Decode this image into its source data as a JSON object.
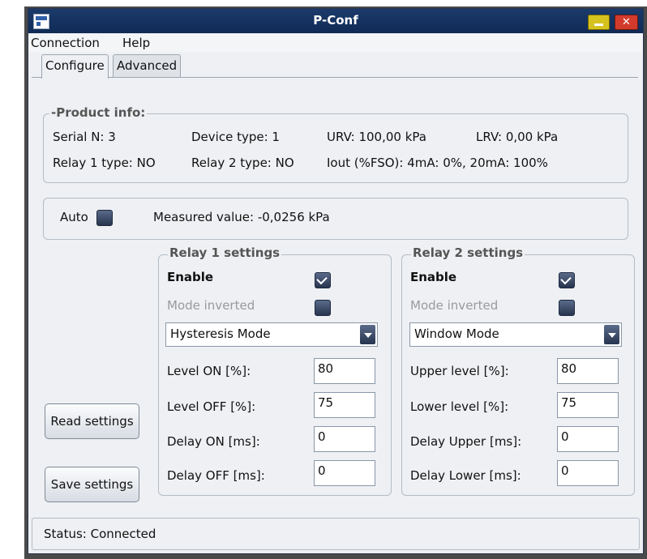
{
  "window": {
    "title": "P-Conf"
  },
  "menu": {
    "items": [
      "Connection",
      "Help"
    ]
  },
  "tabs": [
    "Configure",
    "Advanced"
  ],
  "product_info": {
    "title": "-Product info:",
    "serial": "Serial N: 3",
    "device_type": "Device type: 1",
    "urv": "URV: 100,00 kPa",
    "lrv": "LRV: 0,00 kPa",
    "relay1_type": "Relay 1 type: NO",
    "relay2_type": "Relay 2 type: NO",
    "iout": "Iout (%FSO):  4mA: 0%,  20mA: 100%"
  },
  "measure": {
    "auto_label": "Auto",
    "auto_checked": false,
    "measured_value": "Measured value: -0,0256 kPa"
  },
  "relay1": {
    "title": "Relay 1 settings",
    "enable_label": "Enable",
    "enable_checked": true,
    "mode_inverted_label": "Mode inverted",
    "mode_inverted_checked": false,
    "mode": "Hysteresis Mode",
    "fields": [
      {
        "label": "Level ON   [%]:",
        "value": "80"
      },
      {
        "label": "Level OFF  [%]:",
        "value": "75"
      },
      {
        "label": "Delay ON  [ms]:",
        "value": "0"
      },
      {
        "label": "Delay OFF [ms]:",
        "value": "0"
      }
    ]
  },
  "relay2": {
    "title": "Relay 2 settings",
    "enable_label": "Enable",
    "enable_checked": true,
    "mode_inverted_label": "Mode inverted",
    "mode_inverted_checked": false,
    "mode": "Window Mode",
    "fields": [
      {
        "label": "Upper level [%]:",
        "value": "80"
      },
      {
        "label": "Lower level [%]:",
        "value": "75"
      },
      {
        "label": "Delay Upper [ms]:",
        "value": "0"
      },
      {
        "label": "Delay Lower [ms]:",
        "value": "0"
      }
    ]
  },
  "buttons": {
    "read": "Read settings",
    "save": "Save settings"
  },
  "status": {
    "text": "Status: Connected"
  },
  "icons": {
    "app": "app-window-icon",
    "minimize": "minimize-icon",
    "close": "close-icon",
    "dropdown": "chevron-down-icon"
  },
  "colors": {
    "titlebar": "#0f2a55",
    "minimize": "#d5c21e",
    "close": "#d23b2b",
    "window_bg": "#eef0f3"
  }
}
